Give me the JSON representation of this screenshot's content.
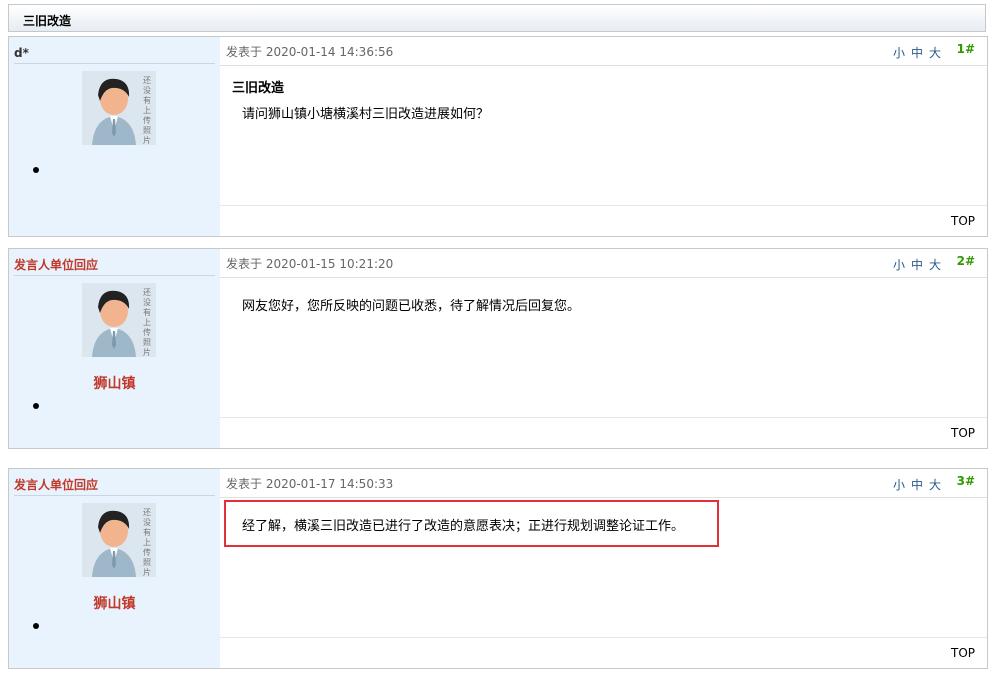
{
  "thread": {
    "title": "三旧改造"
  },
  "ui": {
    "font_small": "小",
    "font_medium": "中",
    "font_large": "大",
    "top_label": "TOP",
    "avatar_stamp": "还没有上传照片"
  },
  "posts": [
    {
      "author": "d*",
      "posted_at": "发表于 2020-01-14 14:36:56",
      "floor": "1#",
      "title": "三旧改造",
      "body": "请问狮山镇小塘横溪村三旧改造进展如何？"
    },
    {
      "author": "发言人单位回应",
      "unit": "狮山镇",
      "posted_at": "发表于 2020-01-15 10:21:20",
      "floor": "2#",
      "body": "网友您好，您所反映的问题已收悉，待了解情况后回复您。"
    },
    {
      "author": "发言人单位回应",
      "unit": "狮山镇",
      "posted_at": "发表于 2020-01-17 14:50:33",
      "floor": "3#",
      "body": "经了解，横溪三旧改造已进行了改造的意愿表决；正进行规划调整论证工作。"
    }
  ],
  "colors": {
    "official": "#c0392b",
    "floor": "#339900",
    "sidebar_bg": "#e9f3fd",
    "highlight": "#e0303a"
  }
}
